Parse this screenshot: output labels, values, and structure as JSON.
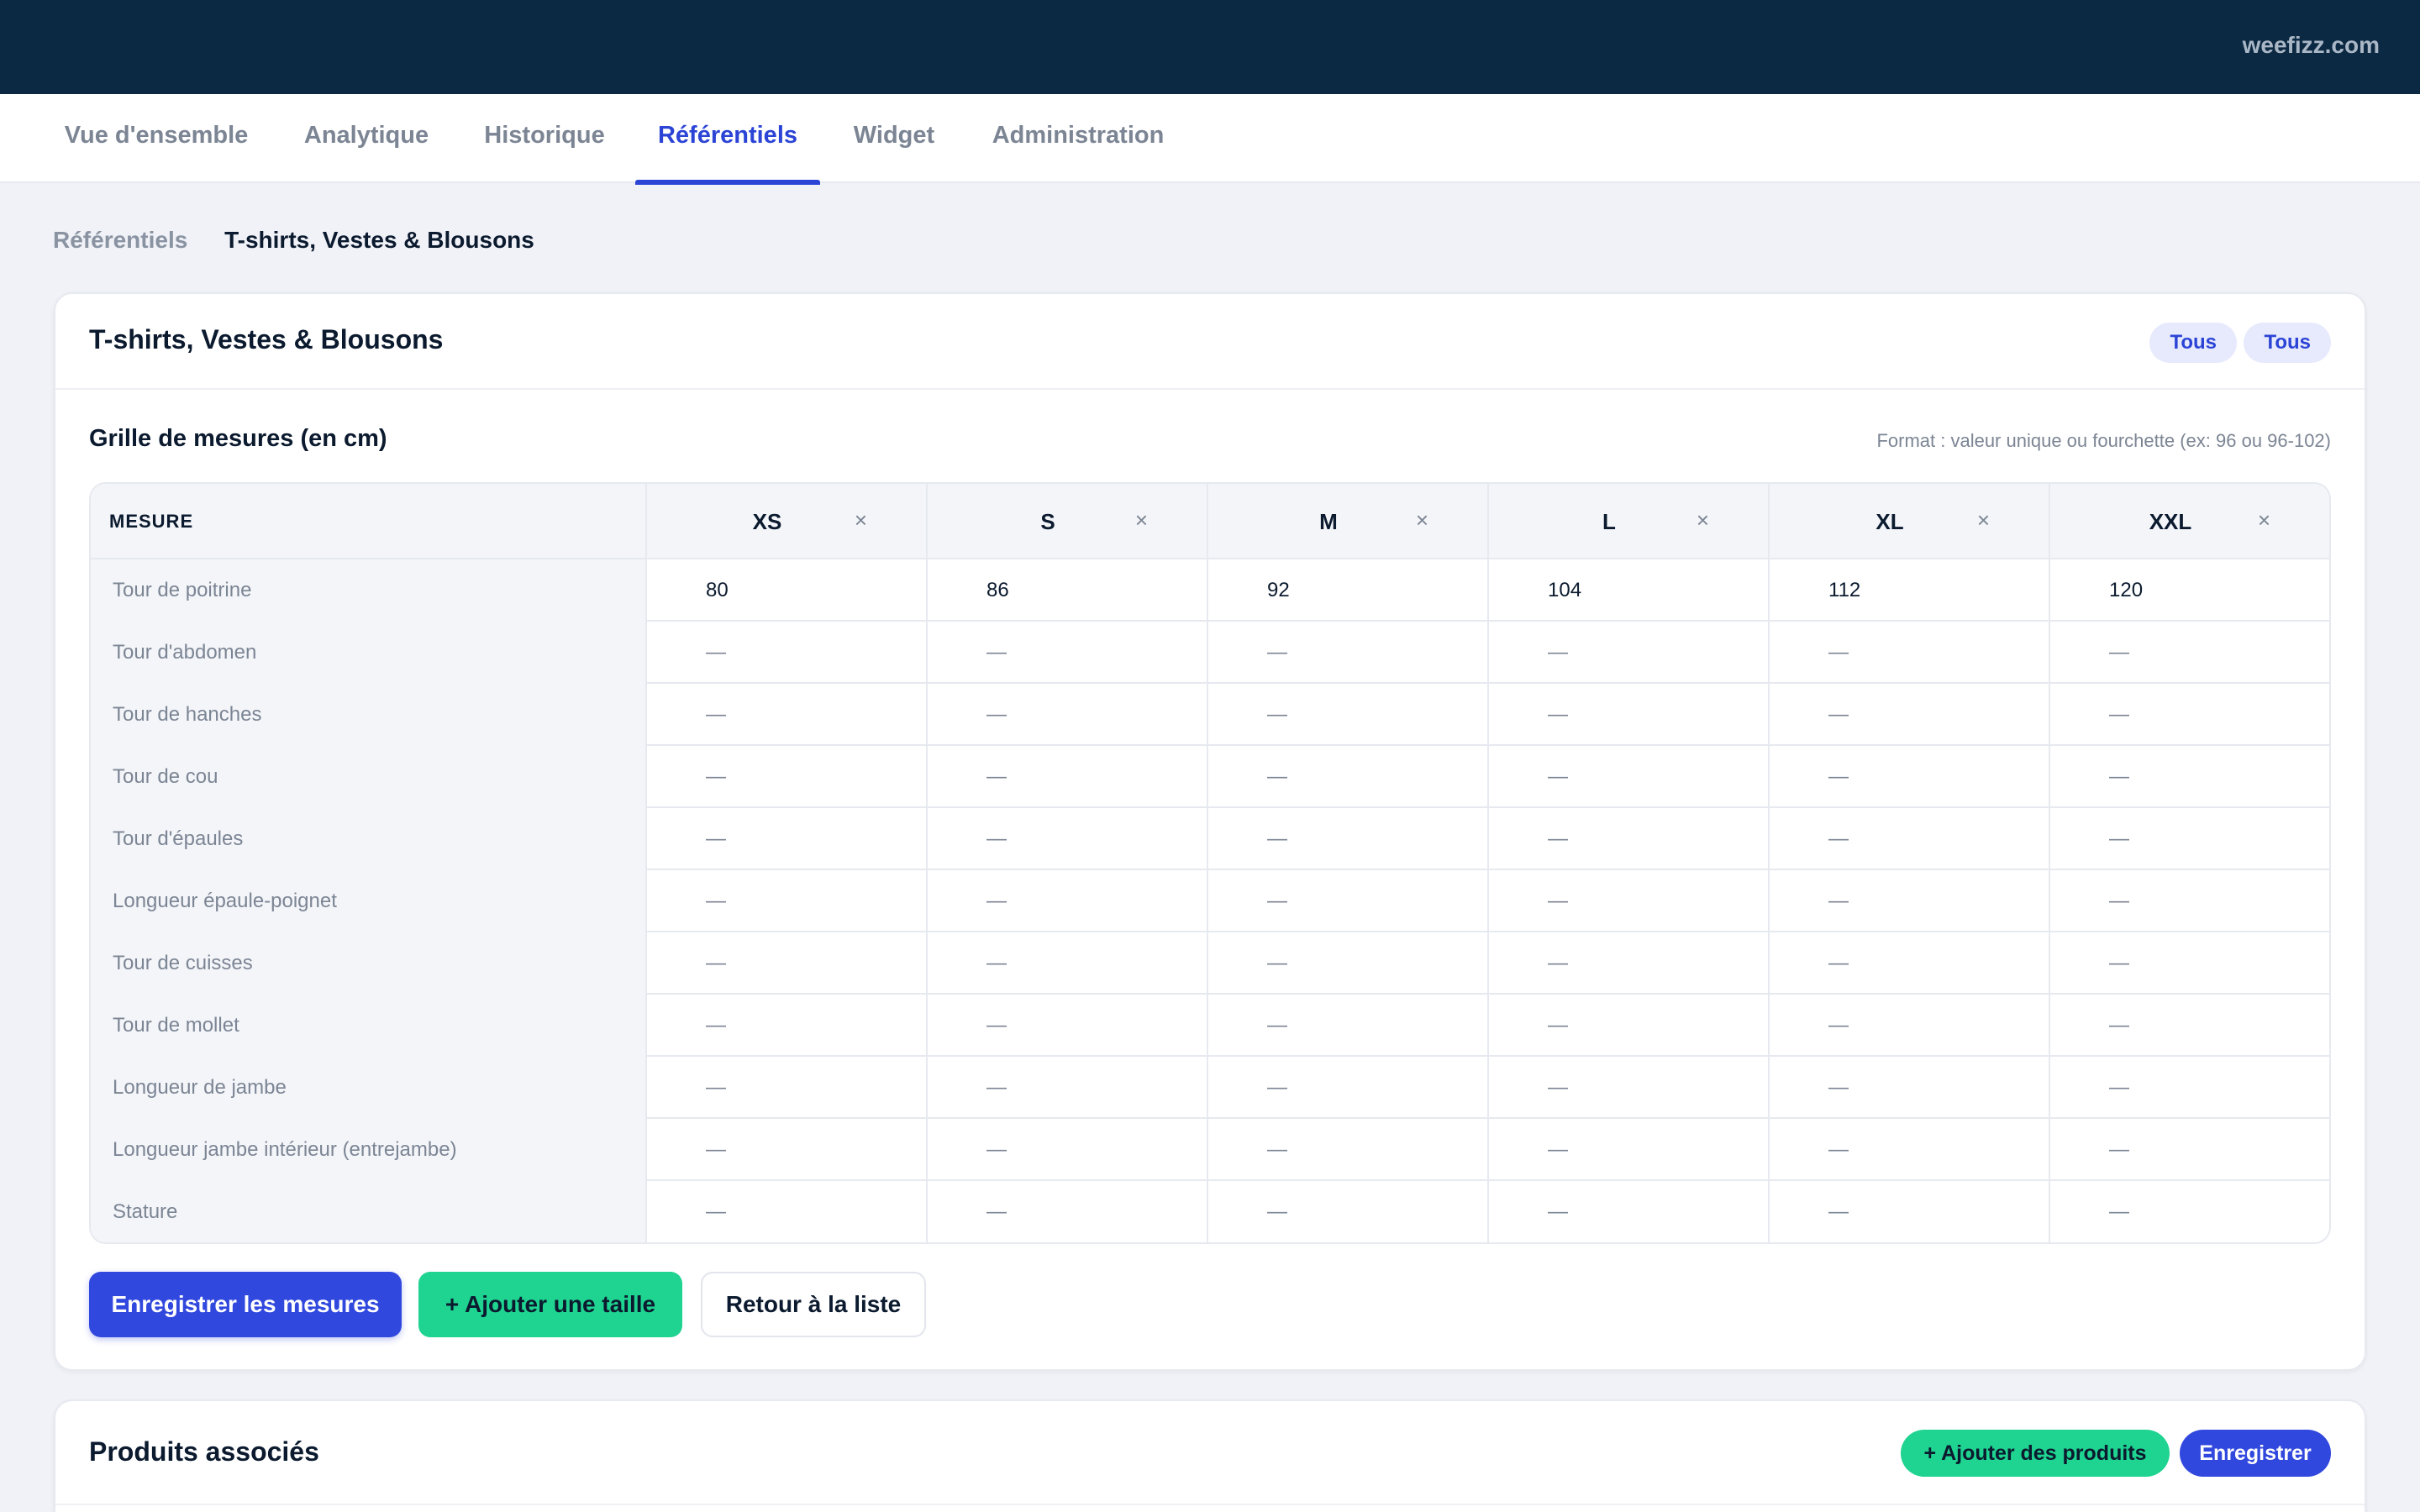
{
  "topbar": {
    "domain": "weefizz.com"
  },
  "tabs": [
    {
      "label": "Vue d'ensemble",
      "active": false
    },
    {
      "label": "Analytique",
      "active": false
    },
    {
      "label": "Historique",
      "active": false
    },
    {
      "label": "Référentiels",
      "active": true
    },
    {
      "label": "Widget",
      "active": false
    },
    {
      "label": "Administration",
      "active": false
    }
  ],
  "breadcrumb": {
    "parent": "Référentiels",
    "current": "T-shirts, Vestes & Blousons"
  },
  "card": {
    "title": "T-shirts, Vestes & Blousons",
    "pills": [
      "Tous",
      "Tous"
    ],
    "section_title": "Grille de mesures (en cm)",
    "format_hint": "Format : valeur unique ou fourchette (ex: 96 ou 96-102)"
  },
  "grid": {
    "header_label": "MESURE",
    "remove_icon": "×",
    "sizes": [
      "XS",
      "S",
      "M",
      "L",
      "XL",
      "XXL"
    ],
    "rows": [
      {
        "label": "Tour de poitrine",
        "values": [
          "80",
          "86",
          "92",
          "104",
          "112",
          "120"
        ]
      },
      {
        "label": "Tour d'abdomen",
        "values": [
          "—",
          "—",
          "—",
          "—",
          "—",
          "—"
        ]
      },
      {
        "label": "Tour de hanches",
        "values": [
          "—",
          "—",
          "—",
          "—",
          "—",
          "—"
        ]
      },
      {
        "label": "Tour de cou",
        "values": [
          "—",
          "—",
          "—",
          "—",
          "—",
          "—"
        ]
      },
      {
        "label": "Tour d'épaules",
        "values": [
          "—",
          "—",
          "—",
          "—",
          "—",
          "—"
        ]
      },
      {
        "label": "Longueur épaule-poignet",
        "values": [
          "—",
          "—",
          "—",
          "—",
          "—",
          "—"
        ]
      },
      {
        "label": "Tour de cuisses",
        "values": [
          "—",
          "—",
          "—",
          "—",
          "—",
          "—"
        ]
      },
      {
        "label": "Tour de mollet",
        "values": [
          "—",
          "—",
          "—",
          "—",
          "—",
          "—"
        ]
      },
      {
        "label": "Longueur de jambe",
        "values": [
          "—",
          "—",
          "—",
          "—",
          "—",
          "—"
        ]
      },
      {
        "label": "Longueur jambe intérieur (entrejambe)",
        "values": [
          "—",
          "—",
          "—",
          "—",
          "—",
          "—"
        ]
      },
      {
        "label": "Stature",
        "values": [
          "—",
          "—",
          "—",
          "—",
          "—",
          "—"
        ]
      }
    ]
  },
  "actions": {
    "save": "Enregistrer les mesures",
    "add_size": "+ Ajouter une taille",
    "back": "Retour à la liste"
  },
  "products": {
    "title": "Produits associés",
    "add_products": "+ Ajouter des produits",
    "save": "Enregistrer"
  }
}
